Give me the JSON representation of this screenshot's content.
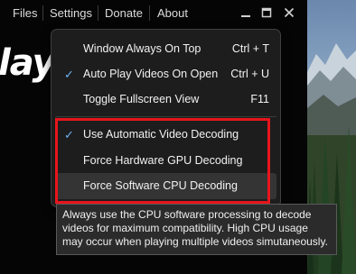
{
  "menubar": {
    "items": [
      {
        "label": "Files"
      },
      {
        "label": "Settings"
      },
      {
        "label": "Donate"
      },
      {
        "label": "About"
      }
    ]
  },
  "window_controls": {
    "minimize_icon": "minimize-icon",
    "maximize_icon": "maximize-icon",
    "close_icon": "close-icon"
  },
  "app_logo": {
    "text": "lay"
  },
  "settings_menu": {
    "items": [
      {
        "label": "Window Always On Top",
        "shortcut": "Ctrl + T",
        "checked": false
      },
      {
        "label": "Auto Play Videos On Open",
        "shortcut": "Ctrl + U",
        "checked": true
      },
      {
        "label": "Toggle Fullscreen View",
        "shortcut": "F11",
        "checked": false
      },
      {
        "label": "Use Automatic Video Decoding",
        "shortcut": "",
        "checked": true
      },
      {
        "label": "Force Hardware GPU Decoding",
        "shortcut": "",
        "checked": false
      },
      {
        "label": "Force Software CPU Decoding",
        "shortcut": "",
        "checked": false,
        "hovered": true
      }
    ],
    "check_glyph": "✓"
  },
  "tooltip": {
    "text": "Always use the CPU software processing to decode videos for maximum compatibility. High CPU usage may occur when playing multiple videos simutaneously."
  },
  "colors": {
    "highlight_box": "#e8141c",
    "checkmark": "#6fb2f5"
  }
}
